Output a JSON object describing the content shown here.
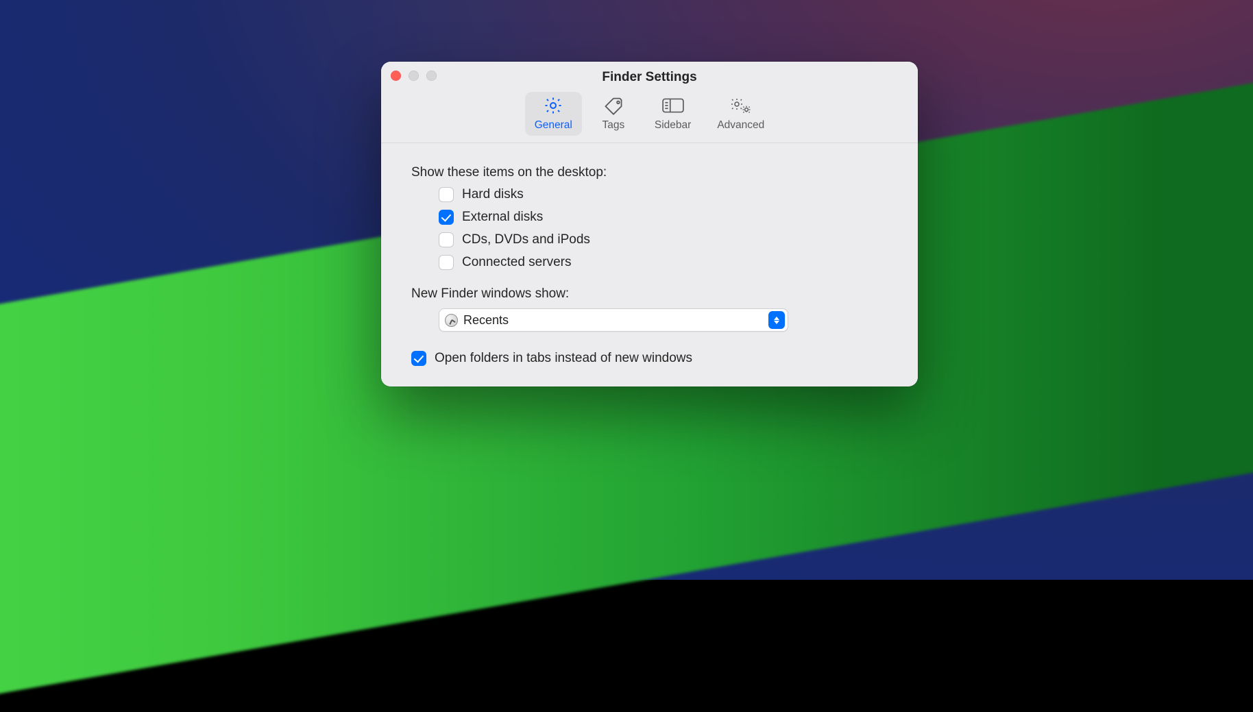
{
  "window": {
    "title": "Finder Settings"
  },
  "tabs": [
    {
      "label": "General",
      "active": true
    },
    {
      "label": "Tags",
      "active": false
    },
    {
      "label": "Sidebar",
      "active": false
    },
    {
      "label": "Advanced",
      "active": false
    }
  ],
  "sections": {
    "desktop_items_label": "Show these items on the desktop:",
    "desktop_items": [
      {
        "label": "Hard disks",
        "checked": false
      },
      {
        "label": "External disks",
        "checked": true
      },
      {
        "label": "CDs, DVDs and iPods",
        "checked": false
      },
      {
        "label": "Connected servers",
        "checked": false
      }
    ],
    "new_window_label": "New Finder windows show:",
    "new_window_value": "Recents",
    "open_in_tabs": {
      "label": "Open folders in tabs instead of new windows",
      "checked": true
    }
  }
}
